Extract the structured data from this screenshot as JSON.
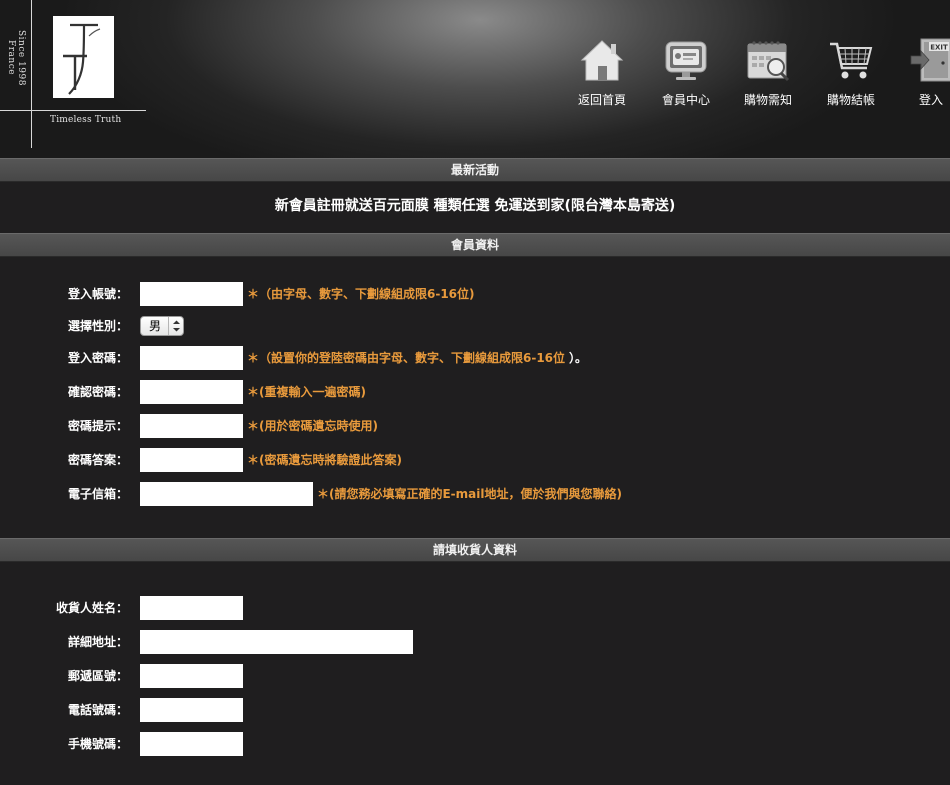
{
  "logo": {
    "since": "Since 1998 France",
    "tagline": "Timeless Truth",
    "mark": "TT"
  },
  "nav": [
    {
      "label": "返回首頁",
      "icon": "home-icon"
    },
    {
      "label": "會員中心",
      "icon": "member-card-icon"
    },
    {
      "label": "購物需知",
      "icon": "calendar-search-icon"
    },
    {
      "label": "購物結帳",
      "icon": "shopping-cart-icon"
    },
    {
      "label": "登入",
      "icon": "exit-door-icon"
    }
  ],
  "sections": {
    "news": "最新活動",
    "member": "會員資料",
    "recipient": "請填收貨人資料"
  },
  "promo": "新會員註冊就送百元面膜 種類任選 免運送到家(限台灣本島寄送)",
  "member_form": {
    "account_label": "登入帳號：",
    "account_hint": "＊（由字母、數字、下劃線組成限6-16位)",
    "gender_label": "選擇性別：",
    "gender_value": "男",
    "password_label": "登入密碼：",
    "password_hint": "＊（設置你的登陸密碼由字母、數字、下劃線組成限6-16位",
    "password_hint_tail": "）。",
    "confirm_label": "確認密碼：",
    "confirm_hint": "＊(重複輸入一遍密碼)",
    "reminder_label": "密碼提示：",
    "reminder_hint": "＊(用於密碼遺忘時使用)",
    "answer_label": "密碼答案：",
    "answer_hint": "＊(密碼遺忘時將驗證此答案)",
    "email_label": "電子信箱：",
    "email_hint": "＊(請您務必填寫正確的E-mail地址，便於我們與您聯絡)"
  },
  "recipient_form": {
    "name_label": "收貨人姓名：",
    "address_label": "詳細地址：",
    "zip_label": "郵遞區號：",
    "phone_label": "電話號碼：",
    "mobile_label": "手機號碼："
  },
  "colors": {
    "background": "#1f1e1f",
    "bar": "#4f4f4f",
    "hint": "#e89a3c"
  }
}
